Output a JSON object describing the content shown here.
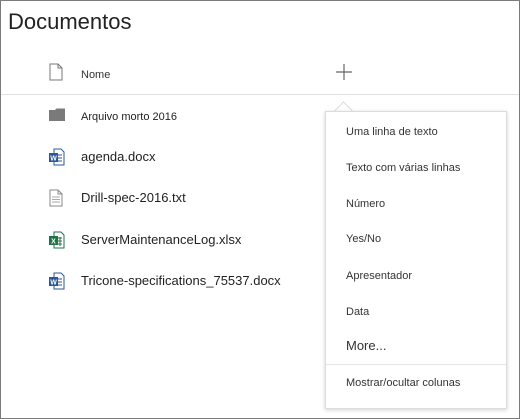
{
  "page": {
    "title": "Documentos"
  },
  "list": {
    "columns": {
      "name": "Nome"
    },
    "add_column_icon": "plus-icon",
    "items": [
      {
        "name": "Arquivo morto 2016",
        "type": "folder",
        "icon": "folder-icon"
      },
      {
        "name": "agenda.docx",
        "type": "word",
        "icon": "word-icon"
      },
      {
        "name": "Drill-spec-2016.txt",
        "type": "text",
        "icon": "text-file-icon"
      },
      {
        "name": "ServerMaintenanceLog.xlsx",
        "type": "excel",
        "icon": "excel-icon"
      },
      {
        "name": "Tricone-specifications_75537.docx",
        "type": "word",
        "icon": "word-icon"
      }
    ]
  },
  "add_column_menu": {
    "items": [
      "Uma linha de texto",
      "Texto com várias linhas",
      "Número",
      "Yes/No",
      "Apresentador",
      "Data",
      "More..."
    ],
    "footer": "Mostrar/ocultar colunas"
  },
  "colors": {
    "word": "#2b579a",
    "excel": "#217346",
    "folder": "#7a7a7a",
    "border": "#7a7a7a"
  }
}
